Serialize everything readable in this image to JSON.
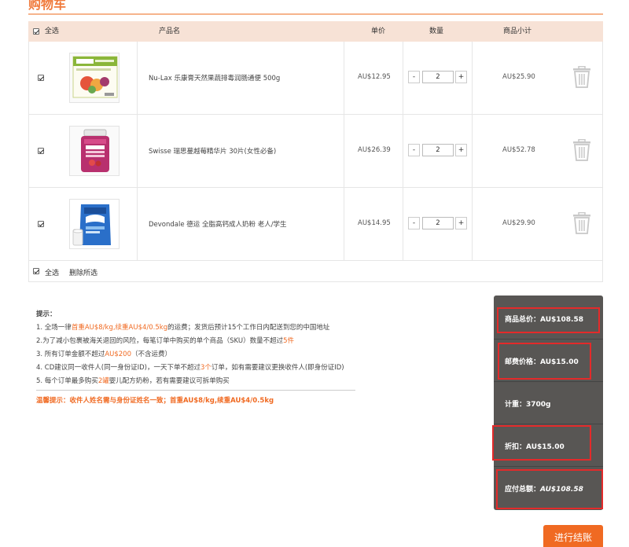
{
  "page": {
    "title": "购物车"
  },
  "header": {
    "select_all": "全选",
    "product_name": "产品名",
    "unit_price": "单价",
    "quantity": "数量",
    "subtotal": "商品小计"
  },
  "items": [
    {
      "checked": true,
      "name": "Nu-Lax 乐康膏天然果蔬排毒润肠通便 500g",
      "price": "AU$12.95",
      "qty": "2",
      "subtotal": "AU$25.90",
      "image_icon": "nu-lax-product-image"
    },
    {
      "checked": true,
      "name": "Swisse 瑞思蔓越莓精华片 30片(女性必备)",
      "price": "AU$26.39",
      "qty": "2",
      "subtotal": "AU$52.78",
      "image_icon": "swisse-cranberry-product-image"
    },
    {
      "checked": true,
      "name": "Devondale 德运 全脂高钙成人奶粉 老人/学生",
      "price": "AU$14.95",
      "qty": "2",
      "subtotal": "AU$29.90",
      "image_icon": "devondale-milk-product-image"
    }
  ],
  "stepper": {
    "minus": "-",
    "plus": "+"
  },
  "footer": {
    "select_all": "全选",
    "delete_selected": "删除所选"
  },
  "tips": {
    "title": "提示：",
    "line1_a": "1. 全场一律",
    "line1_hl": "首重AU$8/kg,续重AU$4/0.5kg",
    "line1_b": "的运费；发货后预计15个工作日内配送到您的中国地址",
    "line2_a": "2.为了减小包裹被海关退回的风险，每笔订单中购买的单个商品（SKU）数量不超过",
    "line2_hl": "5件",
    "line3_a": "3. 所有订单金额不超过",
    "line3_hl": "AU$200",
    "line3_b": "（不含运费）",
    "line4_a": "4. CD建议同一收件人(同一身份证ID)，一天下单不超过",
    "line4_hl": "3个",
    "line4_b": "订单，如有需要建议更换收件人(即身份证ID)",
    "line5_a": "5. 每个订单最多购买",
    "line5_hl": "2罐",
    "line5_b": "婴儿配方奶粉，若有需要建议可拆单购买",
    "warm": "温馨提示：收件人姓名需与身份证姓名一致；首重AU$8/kg,续重AU$4/0.5kg"
  },
  "summary": {
    "goods_total": "商品总价：AU$108.58",
    "shipping": "邮费价格：AU$15.00",
    "weight": "计重：3700g",
    "discount": "折扣：AU$15.00",
    "payable_label": "应付总额：",
    "payable_value": "AU$108.58"
  },
  "checkout": {
    "label": "进行结账"
  },
  "colors": {
    "accent": "#f06a22",
    "header_bg": "#f7e2d6",
    "summary_bg": "#585654",
    "highlight_box": "#e42a2a"
  }
}
